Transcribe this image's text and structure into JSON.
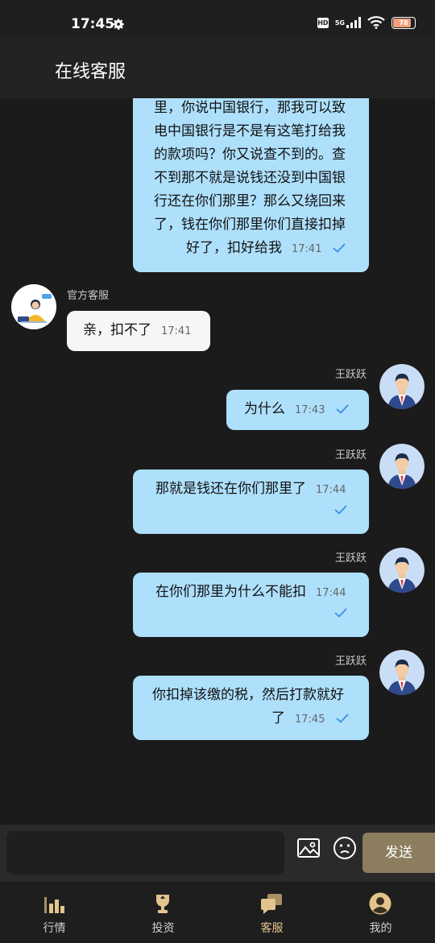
{
  "status_bar": {
    "time": "17:45",
    "network_badge": "HD",
    "network_type": "5G",
    "battery_level": "78"
  },
  "header": {
    "title": "在线客服"
  },
  "messages": [
    {
      "direction": "out",
      "lines": [
        "里，你说中国银行，那我可以致",
        "电中国银行是不是有这笔打给我",
        "的款项吗？你又说查不到的。查",
        "不到那不就是说钱还没到中国银",
        "行还在你们那里？那么又绕回来",
        "了，钱在你们那里你们直接扣掉",
        "好了，扣好给我"
      ],
      "time": "17:41",
      "read": true
    },
    {
      "direction": "in",
      "sender": "官方客服",
      "text": "亲，扣不了",
      "time": "17:41"
    },
    {
      "direction": "out",
      "sender": "王跃跃",
      "text": "为什么",
      "time": "17:43",
      "read": true
    },
    {
      "direction": "out",
      "sender": "王跃跃",
      "text": "那就是钱还在你们那里了",
      "time": "17:44",
      "read": true
    },
    {
      "direction": "out",
      "sender": "王跃跃",
      "text": "在你们那里为什么不能扣",
      "time": "17:44",
      "read": true
    },
    {
      "direction": "out",
      "sender": "王跃跃",
      "lines": [
        "你扣掉该缴的税，然后打款就好",
        "了"
      ],
      "time": "17:45",
      "read": true
    }
  ],
  "input": {
    "value": "",
    "placeholder": "",
    "send_label": "发送"
  },
  "tabs": [
    {
      "label": "行情",
      "icon": "bar-chart-icon",
      "active": false
    },
    {
      "label": "投资",
      "icon": "trophy-icon",
      "active": false
    },
    {
      "label": "客服",
      "icon": "chat-bubbles-icon",
      "active": true
    },
    {
      "label": "我的",
      "icon": "user-icon",
      "active": false
    }
  ],
  "colors": {
    "accent_gold": "#e3c48c",
    "outgoing_bubble": "#aee0fc",
    "incoming_bubble": "#f6f6f6",
    "send_button": "#8c7d5f",
    "check_blue": "#3a8ee6"
  }
}
